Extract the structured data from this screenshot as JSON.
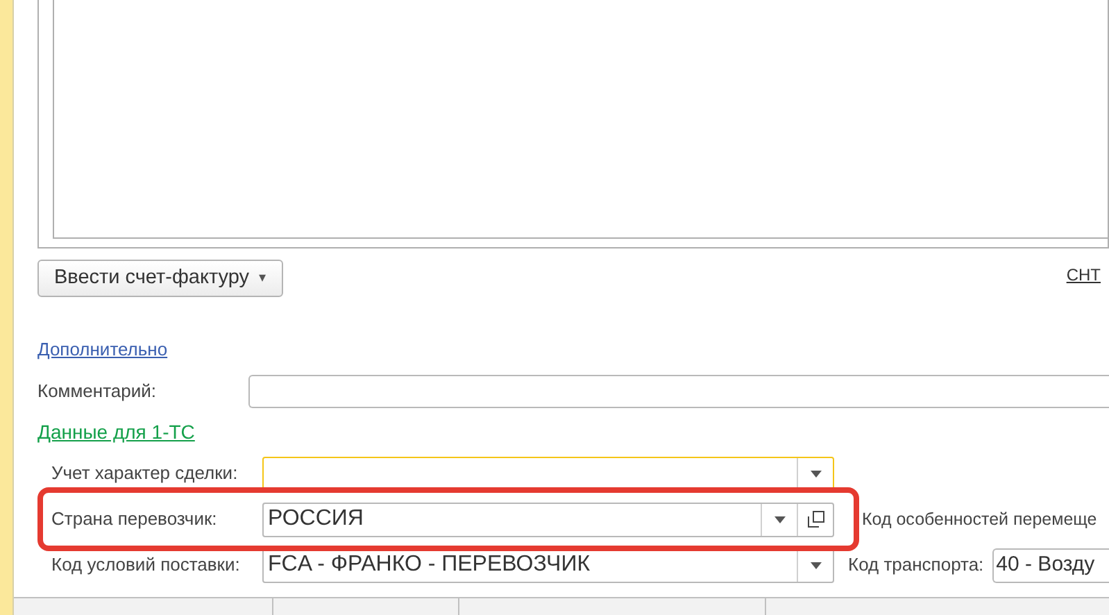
{
  "invoice_button": {
    "label": "Ввести счет-фактуру",
    "caret": "▾"
  },
  "snt_link": "СНТ",
  "more_link": "Дополнительно",
  "comment": {
    "label": "Комментарий:"
  },
  "section_title": "Данные для 1-ТС",
  "rows": [
    {
      "label": "Учет характер сделки:",
      "value": "",
      "focused": true,
      "copy": false,
      "side_label": "",
      "side_value": ""
    },
    {
      "label": "Страна перевозчик:",
      "value": "РОССИЯ",
      "focused": false,
      "copy": true,
      "side_label": "Код особенностей перемеще",
      "side_value": ""
    },
    {
      "label": "Код условий поставки:",
      "value": "FCA - ФРАНКО - ПЕРЕВОЗЧИК",
      "focused": false,
      "copy": false,
      "side_label": "Код транспорта:",
      "side_value": "40 - Возду"
    }
  ]
}
